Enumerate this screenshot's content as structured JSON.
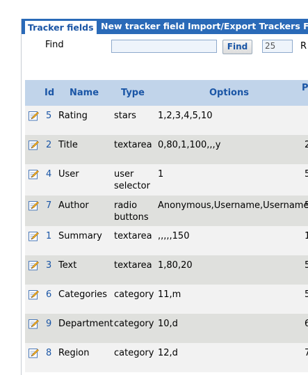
{
  "tabs": [
    {
      "label": "Tracker fields",
      "active": true
    },
    {
      "label": "New tracker field"
    },
    {
      "label": "Import/Export Trackers Fiel"
    }
  ],
  "find": {
    "label": "Find",
    "button_label": "Find",
    "value": "",
    "per_page": "25",
    "trailing_text": "R"
  },
  "table": {
    "headers": {
      "id": "Id",
      "name": "Name",
      "type": "Type",
      "options": "Options",
      "extra": "P"
    },
    "rows": [
      {
        "id": "5",
        "name": "Rating",
        "type": [
          "stars"
        ],
        "options": "1,2,3,4,5,10",
        "extra": ""
      },
      {
        "id": "2",
        "name": "Title",
        "type": [
          "textarea"
        ],
        "options": "0,80,1,100,,,y",
        "extra": "2"
      },
      {
        "id": "4",
        "name": "User",
        "type": [
          "user",
          "selector"
        ],
        "options": "1",
        "extra": "5"
      },
      {
        "id": "7",
        "name": "Author",
        "type": [
          "radio",
          "buttons"
        ],
        "options": "Anonymous,Username,Username",
        "extra": "5"
      },
      {
        "id": "1",
        "name": "Summary",
        "type": [
          "textarea"
        ],
        "options": ",,,,,150",
        "extra": "1"
      },
      {
        "id": "3",
        "name": "Text",
        "type": [
          "textarea"
        ],
        "options": "1,80,20",
        "extra": "5"
      },
      {
        "id": "6",
        "name": "Categories",
        "type": [
          "category"
        ],
        "options": "11,m",
        "extra": "5"
      },
      {
        "id": "9",
        "name": "Department",
        "type": [
          "category"
        ],
        "options": "10,d",
        "extra": "6"
      },
      {
        "id": "8",
        "name": "Region",
        "type": [
          "category"
        ],
        "options": "12,d",
        "extra": "7"
      }
    ]
  },
  "icons": {
    "edit": "edit-pencil-icon"
  },
  "colors": {
    "tab_bar": "#2a6ab8",
    "header_bg": "#c1d4ea",
    "link": "#1b56a6",
    "row_odd": "#f2f2f2",
    "row_even": "#dfe0dd"
  }
}
